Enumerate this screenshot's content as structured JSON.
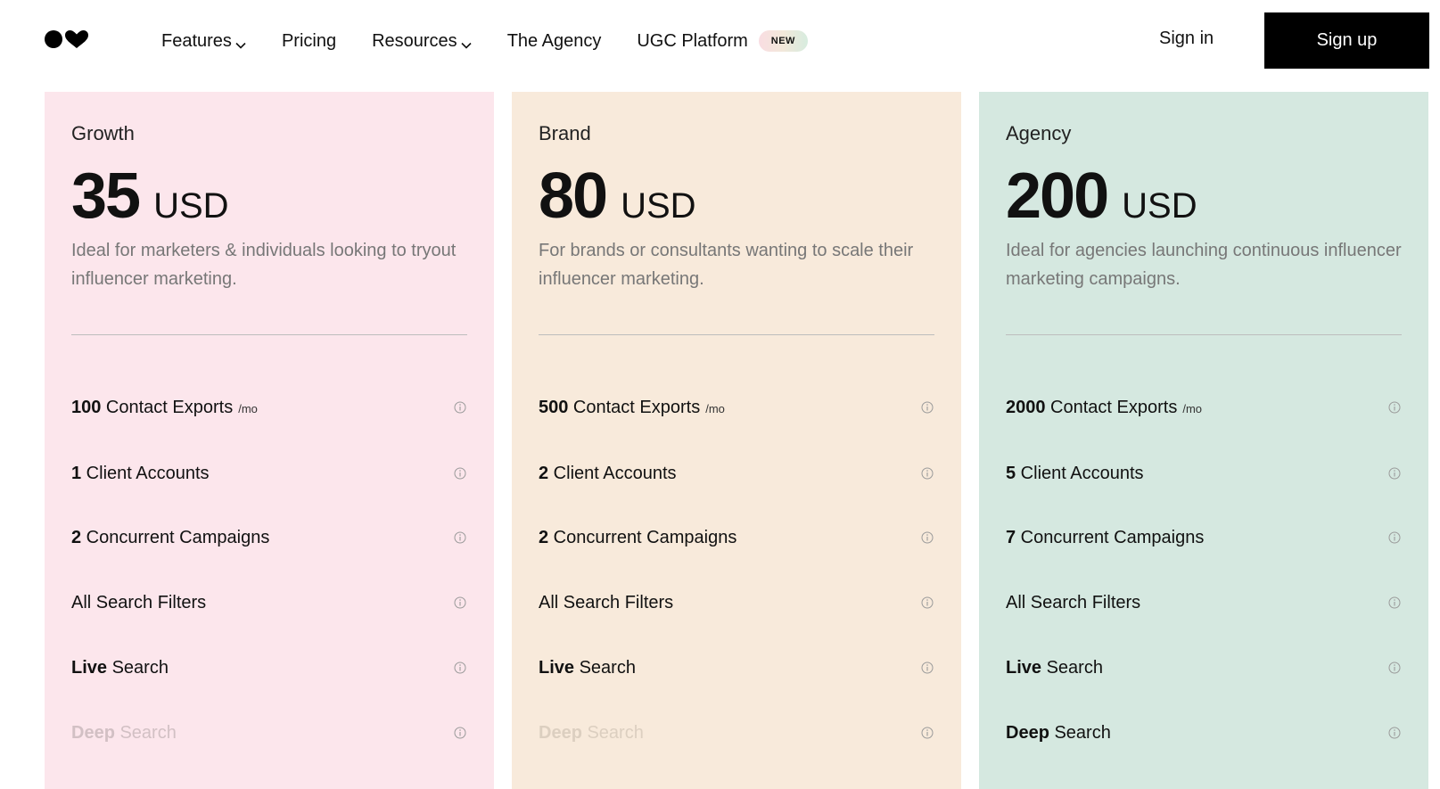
{
  "header": {
    "logo_name": "heart-dot-logo",
    "nav": [
      {
        "label": "Features",
        "has_dropdown": true
      },
      {
        "label": "Pricing",
        "has_dropdown": false
      },
      {
        "label": "Resources",
        "has_dropdown": true
      },
      {
        "label": "The Agency",
        "has_dropdown": false
      },
      {
        "label": "UGC Platform",
        "has_dropdown": false,
        "badge": "NEW"
      }
    ],
    "sign_in": "Sign in",
    "sign_up": "Sign up"
  },
  "plans": [
    {
      "name": "Growth",
      "price": "35",
      "currency": "USD",
      "description": "Ideal for marketers & individuals looking to tryout influencer marketing.",
      "background": "#fce6ec",
      "features": [
        {
          "strong": "100",
          "text": " Contact Exports",
          "unit": "/mo",
          "enabled": true
        },
        {
          "strong": "1",
          "text": " Client Accounts",
          "enabled": true
        },
        {
          "strong": "2",
          "text": " Concurrent Campaigns",
          "enabled": true
        },
        {
          "strong": "",
          "text": "All Search Filters",
          "enabled": true
        },
        {
          "strong": "Live",
          "text": " Search",
          "enabled": true
        },
        {
          "strong": "Deep",
          "text": " Search",
          "enabled": false
        }
      ]
    },
    {
      "name": "Brand",
      "price": "80",
      "currency": "USD",
      "description": "For brands or consultants wanting to scale their influencer marketing.",
      "background": "#f8eadb",
      "features": [
        {
          "strong": "500",
          "text": " Contact Exports",
          "unit": "/mo",
          "enabled": true
        },
        {
          "strong": "2",
          "text": " Client Accounts",
          "enabled": true
        },
        {
          "strong": "2",
          "text": " Concurrent Campaigns",
          "enabled": true
        },
        {
          "strong": "",
          "text": "All Search Filters",
          "enabled": true
        },
        {
          "strong": "Live",
          "text": " Search",
          "enabled": true
        },
        {
          "strong": "Deep",
          "text": " Search",
          "enabled": false
        }
      ]
    },
    {
      "name": "Agency",
      "price": "200",
      "currency": "USD",
      "description": "Ideal for agencies launching continuous influencer marketing campaigns.",
      "background": "#d5e8e0",
      "features": [
        {
          "strong": "2000",
          "text": " Contact Exports",
          "unit": "/mo",
          "enabled": true
        },
        {
          "strong": "5",
          "text": " Client Accounts",
          "enabled": true
        },
        {
          "strong": "7",
          "text": " Concurrent Campaigns",
          "enabled": true
        },
        {
          "strong": "",
          "text": "All Search Filters",
          "enabled": true
        },
        {
          "strong": "Live",
          "text": " Search",
          "enabled": true
        },
        {
          "strong": "Deep",
          "text": " Search",
          "enabled": true
        }
      ]
    }
  ],
  "icons": {
    "info": "info-circle-icon",
    "dropdown": "chevron-down-icon"
  }
}
